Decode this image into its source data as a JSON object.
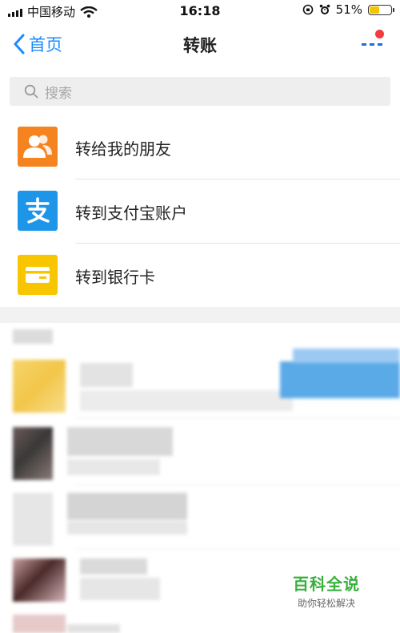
{
  "status_bar": {
    "carrier": "中国移动",
    "time": "16:18",
    "battery": "51%",
    "battery_level": 0.51
  },
  "nav": {
    "back_label": "首页",
    "title": "转账"
  },
  "search": {
    "placeholder": "搜索"
  },
  "options": [
    {
      "label": "转给我的朋友",
      "icon": "friends-icon",
      "color": "#f5831f"
    },
    {
      "label": "转到支付宝账户",
      "icon": "alipay-icon",
      "color": "#1d95e8"
    },
    {
      "label": "转到银行卡",
      "icon": "bank-card-icon",
      "color": "#f7c600"
    }
  ],
  "watermark": {
    "main": "百科全说",
    "sub": "助你轻松解决"
  },
  "colors": {
    "accent": "#1a8cff",
    "badge": "#f23b3b"
  }
}
